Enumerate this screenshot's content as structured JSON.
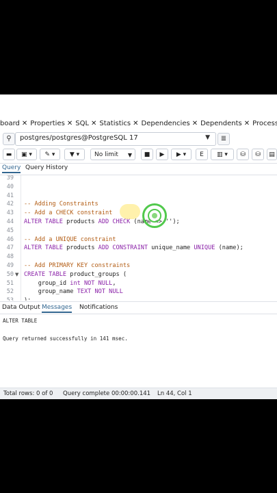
{
  "tabs": [
    "board",
    "Properties",
    "SQL",
    "Statistics",
    "Dependencies",
    "Dependents",
    "Processes"
  ],
  "connection": {
    "label": "postgres/postgres@PostgreSQL 17"
  },
  "toolbar": {
    "limit": "No limit"
  },
  "query_tabs": {
    "query": "Query",
    "history": "Query History"
  },
  "editor": {
    "lines": [
      {
        "n": "39",
        "tokens": []
      },
      {
        "n": "40",
        "tokens": []
      },
      {
        "n": "41",
        "tokens": []
      },
      {
        "n": "42",
        "tokens": [
          {
            "t": "-- Adding Constraints",
            "c": "cm"
          }
        ]
      },
      {
        "n": "43",
        "tokens": [
          {
            "t": "-- Add a CHECK constraint",
            "c": "cm"
          }
        ]
      },
      {
        "n": "44",
        "tokens": [
          {
            "t": "ALTER TABLE",
            "c": "kw"
          },
          {
            "t": " products ",
            "c": "fn"
          },
          {
            "t": "ADD CHECK",
            "c": "kw"
          },
          {
            "t": " (name <> '');",
            "c": "fn"
          }
        ]
      },
      {
        "n": "45",
        "tokens": []
      },
      {
        "n": "46",
        "tokens": [
          {
            "t": "-- Add a UNIQUE constraint",
            "c": "cm"
          }
        ]
      },
      {
        "n": "47",
        "tokens": [
          {
            "t": "ALTER TABLE",
            "c": "kw"
          },
          {
            "t": " products ",
            "c": "fn"
          },
          {
            "t": "ADD CONSTRAINT",
            "c": "kw"
          },
          {
            "t": " unique_name ",
            "c": "fn"
          },
          {
            "t": "UNIQUE",
            "c": "kw"
          },
          {
            "t": " (name);",
            "c": "fn"
          }
        ]
      },
      {
        "n": "48",
        "tokens": []
      },
      {
        "n": "49",
        "tokens": [
          {
            "t": "-- Add PRIMARY KEY constraints",
            "c": "cm"
          }
        ]
      },
      {
        "n": "50",
        "fold": true,
        "tokens": [
          {
            "t": "CREATE TABLE",
            "c": "kw"
          },
          {
            "t": " product_groups (",
            "c": "fn"
          }
        ]
      },
      {
        "n": "51",
        "tokens": [
          {
            "t": "    group_id ",
            "c": "fn"
          },
          {
            "t": "int NOT NULL",
            "c": "kw"
          },
          {
            "t": ",",
            "c": "fn"
          }
        ]
      },
      {
        "n": "52",
        "tokens": [
          {
            "t": "    group_name ",
            "c": "fn"
          },
          {
            "t": "TEXT NOT NULL",
            "c": "kw"
          }
        ]
      },
      {
        "n": "53",
        "tokens": [
          {
            "t": ");",
            "c": "fn"
          }
        ]
      }
    ]
  },
  "output_tabs": {
    "data": "Data Output",
    "messages": "Messages",
    "notifications": "Notifications"
  },
  "messages": {
    "line1": "ALTER TABLE",
    "line2": "Query returned successfully in 141 msec."
  },
  "status": {
    "rows": "Total rows: 0 of 0",
    "complete": "Query complete 00:00:00.141",
    "pos": "Ln 44, Col 1"
  }
}
